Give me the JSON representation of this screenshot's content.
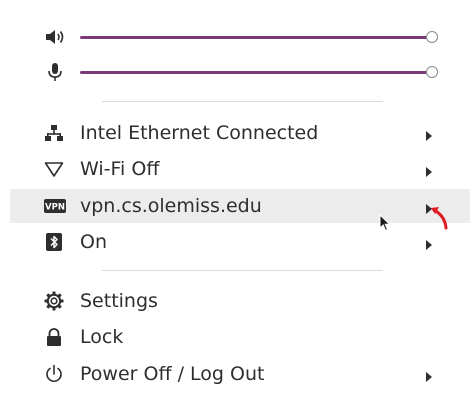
{
  "colors": {
    "slider_fill": "#7b3a7a",
    "background": "#ffffff",
    "hover": "#ececec",
    "text": "#2e2e2e",
    "annotation": "#e01b24"
  },
  "sliders": {
    "volume": {
      "icon": "speaker-volume-icon",
      "level": 1.0
    },
    "microphone": {
      "icon": "microphone-icon",
      "level": 1.0
    }
  },
  "menu": {
    "network": {
      "icon": "wired-network-icon",
      "label": "Intel Ethernet Connected"
    },
    "wifi": {
      "icon": "wifi-icon",
      "label": "Wi-Fi Off"
    },
    "vpn": {
      "icon": "vpn-icon",
      "label": "vpn.cs.olemiss.edu",
      "icon_text": "VPN"
    },
    "bluetooth": {
      "icon": "bluetooth-icon",
      "label": "On"
    },
    "settings": {
      "icon": "gear-icon",
      "label": "Settings"
    },
    "lock": {
      "icon": "lock-icon",
      "label": "Lock"
    },
    "power": {
      "icon": "power-icon",
      "label": "Power Off / Log Out"
    }
  }
}
